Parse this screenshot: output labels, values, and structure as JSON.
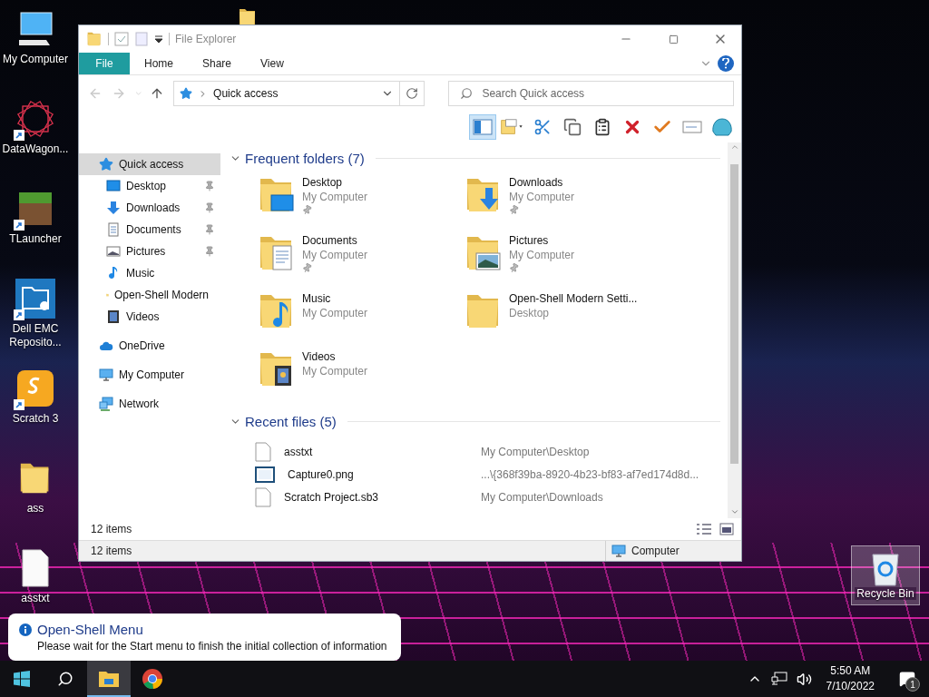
{
  "desktop_icons": [
    {
      "label": "My Computer",
      "kind": "computer",
      "shortcut": false
    },
    {
      "label": "DataWagon...",
      "kind": "star-pattern",
      "shortcut": true
    },
    {
      "label": "TLauncher",
      "kind": "block",
      "shortcut": true
    },
    {
      "label": "Dell EMC Reposito...",
      "kind": "folder-gear",
      "shortcut": true
    },
    {
      "label": "Scratch 3",
      "kind": "app",
      "shortcut": true
    },
    {
      "label": "ass",
      "kind": "folder",
      "shortcut": false
    },
    {
      "label": "asstxt",
      "kind": "document",
      "shortcut": false
    }
  ],
  "recycle_bin": {
    "label": "Recycle Bin",
    "selected": true
  },
  "window": {
    "title": "File Explorer",
    "ribbon_tabs": [
      {
        "label": "File",
        "selected": true
      },
      {
        "label": "Home",
        "selected": false
      },
      {
        "label": "Share",
        "selected": false
      },
      {
        "label": "View",
        "selected": false
      }
    ],
    "address": "Quick access",
    "search": {
      "placeholder": "Search Quick access"
    },
    "toolbar": [
      {
        "kind": "pane",
        "selected": true
      },
      {
        "kind": "properties",
        "selected": false
      },
      {
        "kind": "cut",
        "selected": false
      },
      {
        "kind": "copy",
        "selected": false
      },
      {
        "kind": "paste",
        "selected": false
      },
      {
        "kind": "delete",
        "selected": false
      },
      {
        "kind": "check",
        "selected": false
      },
      {
        "kind": "rename",
        "selected": false
      },
      {
        "kind": "shell",
        "selected": false
      }
    ],
    "sidebar": [
      {
        "label": "Quick access",
        "kind": "star",
        "selected": true,
        "children": [
          {
            "label": "Desktop",
            "kind": "desktop",
            "pinned": true,
            "selected": false
          },
          {
            "label": "Downloads",
            "kind": "downloads",
            "pinned": true,
            "selected": false
          },
          {
            "label": "Documents",
            "kind": "documents",
            "pinned": true,
            "selected": false
          },
          {
            "label": "Pictures",
            "kind": "pictures",
            "pinned": true,
            "selected": false
          },
          {
            "label": "Music",
            "kind": "music",
            "pinned": false,
            "selected": false
          },
          {
            "label": "Open-Shell Modern",
            "kind": "folder",
            "pinned": false,
            "selected": false
          },
          {
            "label": "Videos",
            "kind": "videos",
            "pinned": false,
            "selected": false
          }
        ]
      },
      {
        "label": "OneDrive",
        "kind": "cloud",
        "selected": false
      },
      {
        "label": "My Computer",
        "kind": "computer",
        "selected": false
      },
      {
        "label": "Network",
        "kind": "network",
        "selected": false
      }
    ],
    "frequent_folders": {
      "title": "Frequent folders (7)",
      "expanded": true,
      "items": [
        {
          "name": "Desktop",
          "location": "My Computer",
          "kind": "desktop",
          "pinned": true
        },
        {
          "name": "Downloads",
          "location": "My Computer",
          "kind": "downloads",
          "pinned": true
        },
        {
          "name": "Documents",
          "location": "My Computer",
          "kind": "documents",
          "pinned": true
        },
        {
          "name": "Pictures",
          "location": "My Computer",
          "kind": "pictures",
          "pinned": true
        },
        {
          "name": "Music",
          "location": "My Computer",
          "kind": "music",
          "pinned": false
        },
        {
          "name": "Open-Shell Modern Setti...",
          "location": "Desktop",
          "kind": "folder",
          "pinned": false
        },
        {
          "name": "Videos",
          "location": "My Computer",
          "kind": "videos",
          "pinned": false
        }
      ]
    },
    "recent_files": {
      "title": "Recent files (5)",
      "expanded": true,
      "items": [
        {
          "name": "asstxt",
          "path": "My Computer\\Desktop",
          "kind": "text"
        },
        {
          "name": "Capture0.png",
          "path": "...\\{368f39ba-8920-4b23-bf83-af7ed174d8d...",
          "kind": "image"
        },
        {
          "name": "Scratch Project.sb3",
          "path": "My Computer\\Downloads",
          "kind": "text"
        }
      ]
    },
    "item_count": "12 items",
    "status_bar": {
      "item_count": "12 items",
      "location": "Computer"
    }
  },
  "balloon": {
    "title": "Open-Shell Menu",
    "message": "Please wait for the Start menu to finish the initial collection of information"
  },
  "taskbar": {
    "apps": [
      {
        "kind": "start",
        "selected": false
      },
      {
        "kind": "search",
        "selected": false
      },
      {
        "kind": "explorer",
        "selected": true
      },
      {
        "kind": "browser",
        "selected": false
      }
    ],
    "time": "5:50 AM",
    "date": "7/10/2022",
    "notification_count": "1"
  }
}
